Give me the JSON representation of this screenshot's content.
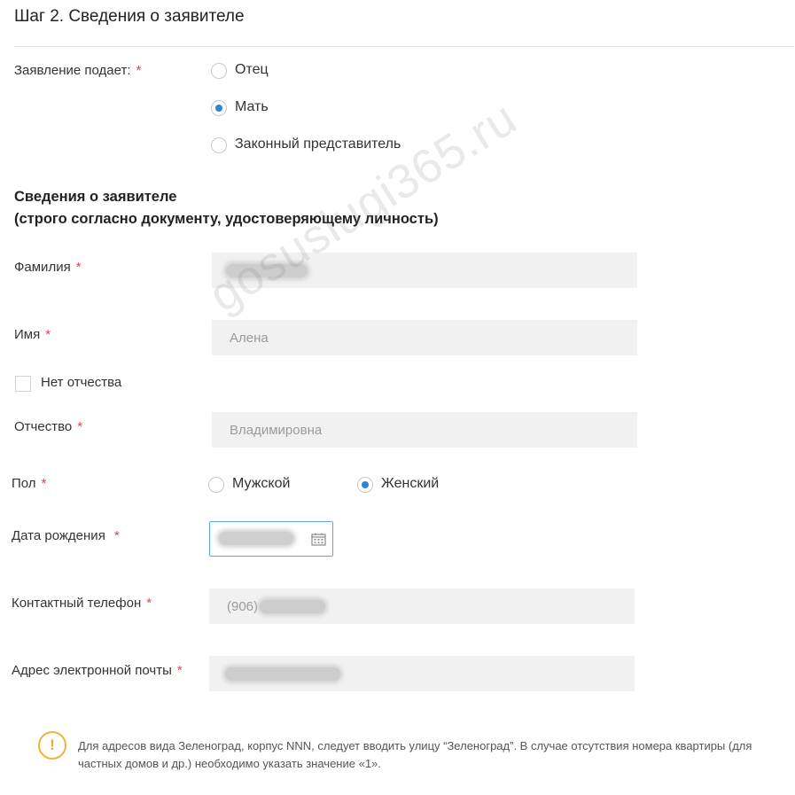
{
  "step_title": "Шаг 2. Сведения о заявителе",
  "applicant": {
    "label": "Заявление подает:",
    "required_mark": "*",
    "options": [
      {
        "label": "Отец",
        "selected": false
      },
      {
        "label": "Мать",
        "selected": true
      },
      {
        "label": "Законный представитель",
        "selected": false
      }
    ]
  },
  "section": {
    "title_line1": "Сведения о заявителе",
    "title_line2": "(строго согласно документу, удостоверяющему личность)"
  },
  "fields": {
    "surname": {
      "label": "Фамилия",
      "required_mark": "*",
      "value": ""
    },
    "name": {
      "label": "Имя",
      "required_mark": "*",
      "value": "Алена"
    },
    "no_patronymic": {
      "label": "Нет отчества",
      "checked": false
    },
    "patronymic": {
      "label": "Отчество",
      "required_mark": "*",
      "value": "Владимировна"
    },
    "gender": {
      "label": "Пол",
      "required_mark": "*",
      "options": [
        {
          "label": "Мужской",
          "selected": false
        },
        {
          "label": "Женский",
          "selected": true
        }
      ]
    },
    "birth_date": {
      "label": "Дата рождения",
      "required_mark": "*",
      "value": "",
      "icon": "calendar-icon"
    },
    "phone": {
      "label": "Контактный телефон",
      "required_mark": "*",
      "value": "(906)"
    },
    "email": {
      "label": "Адрес электронной почты",
      "required_mark": "*",
      "value": ""
    }
  },
  "note": {
    "icon": "warning-icon",
    "icon_glyph": "!",
    "text": "Для адресов вида Зеленоград, корпус NNN, следует вводить улицу “Зеленоград”. В случае отсутствия номера квартиры (для частных домов и др.) необходимо указать значение «1»."
  },
  "watermark": "gosuslugi365.ru",
  "colors": {
    "accent": "#2b87d6",
    "required": "#e0474c",
    "warning": "#f2b33d",
    "field_bg": "#f1f1f1"
  }
}
